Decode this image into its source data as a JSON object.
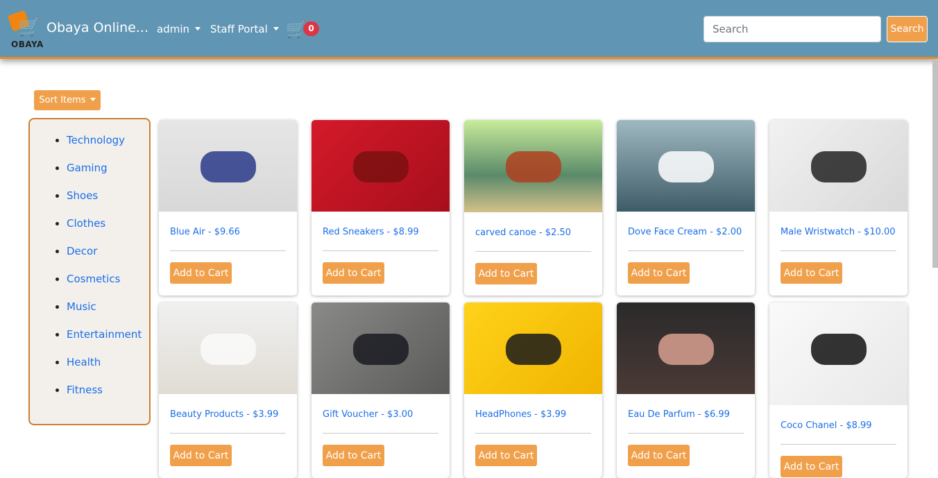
{
  "nav": {
    "logo_text": "OBAYA",
    "brand": "Obaya Online...",
    "admin": "admin",
    "staff": "Staff Portal",
    "cart_count": "0",
    "search_placeholder": "Search",
    "search_button": "Search"
  },
  "sort_label": "Sort Items",
  "categories": [
    "Technology",
    "Gaming",
    "Shoes",
    "Clothes",
    "Decor",
    "Cosmetics",
    "Music",
    "Entertainment",
    "Health",
    "Fitness"
  ],
  "add_label": "Add to Cart",
  "products": [
    {
      "title": "Blue Air - $9.66",
      "img": "linear-gradient(180deg,#e6e6e6,#d8d8d8)",
      "accent": "#2a3a8a"
    },
    {
      "title": "Red Sneakers - $8.99",
      "img": "linear-gradient(135deg,#d41a2a,#a80e1c)",
      "accent": "#7a1010"
    },
    {
      "title": "carved canoe - $2.50",
      "img": "linear-gradient(180deg,#c8ec9a,#5a8a6a 60%,#d4c08a)",
      "accent": "#b04020"
    },
    {
      "title": "Dove Face Cream - $2.00",
      "img": "linear-gradient(180deg,#9fb8c0,#3e5c68)",
      "accent": "#ffffff"
    },
    {
      "title": "Male Wristwatch - $10.00",
      "img": "linear-gradient(135deg,#f2f2f2,#d8d8d8)",
      "accent": "#222222"
    },
    {
      "title": "Beauty Products - $3.99",
      "img": "linear-gradient(180deg,#f0f0f0,#e0dcd4)",
      "accent": "#fafafa"
    },
    {
      "title": "Gift Voucher - $3.00",
      "img": "linear-gradient(135deg,#8a8a88,#5a5a58)",
      "accent": "#1a1a22"
    },
    {
      "title": "HeadPhones - $3.99",
      "img": "linear-gradient(135deg,#ffd21a,#f0b400)",
      "accent": "#1a1a1a"
    },
    {
      "title": "Eau De Parfum - $6.99",
      "img": "linear-gradient(180deg,#2a2a2a,#4a3a36)",
      "accent": "#d8a090"
    },
    {
      "title": "Coco Chanel - $8.99",
      "img": "linear-gradient(135deg,#fafafa,#e8e8e8)",
      "accent": "#111111"
    }
  ]
}
